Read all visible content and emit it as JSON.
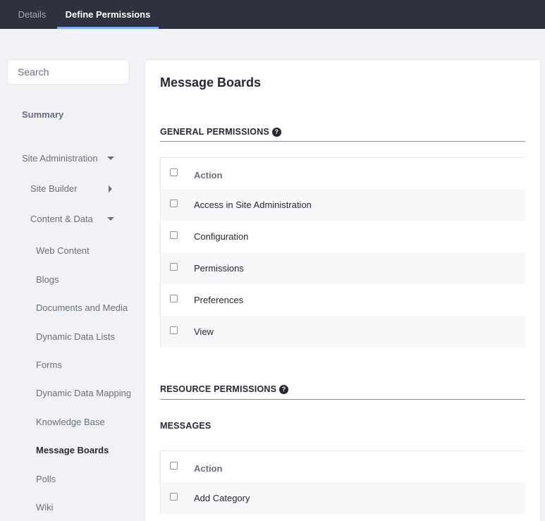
{
  "tabs": [
    {
      "label": "Details"
    },
    {
      "label": "Define Permissions"
    }
  ],
  "search": {
    "placeholder": "Search"
  },
  "sidebar": {
    "summary": "Summary",
    "site_administration": "Site Administration",
    "site_builder": "Site Builder",
    "content_data": "Content & Data",
    "items": [
      {
        "label": "Web Content"
      },
      {
        "label": "Blogs"
      },
      {
        "label": "Documents and Media"
      },
      {
        "label": "Dynamic Data Lists"
      },
      {
        "label": "Forms"
      },
      {
        "label": "Dynamic Data Mapping"
      },
      {
        "label": "Knowledge Base"
      },
      {
        "label": "Message Boards"
      },
      {
        "label": "Polls"
      },
      {
        "label": "Wiki"
      }
    ]
  },
  "main": {
    "title": "Message Boards",
    "general": {
      "title": "GENERAL PERMISSIONS",
      "help_glyph": "?",
      "header": "Action",
      "rows": [
        {
          "label": "Access in Site Administration"
        },
        {
          "label": "Configuration"
        },
        {
          "label": "Permissions"
        },
        {
          "label": "Preferences"
        },
        {
          "label": "View"
        }
      ]
    },
    "resource": {
      "title": "RESOURCE PERMISSIONS",
      "help_glyph": "?",
      "subsection": "MESSAGES",
      "header": "Action",
      "rows": [
        {
          "label": "Add Category"
        }
      ]
    }
  }
}
